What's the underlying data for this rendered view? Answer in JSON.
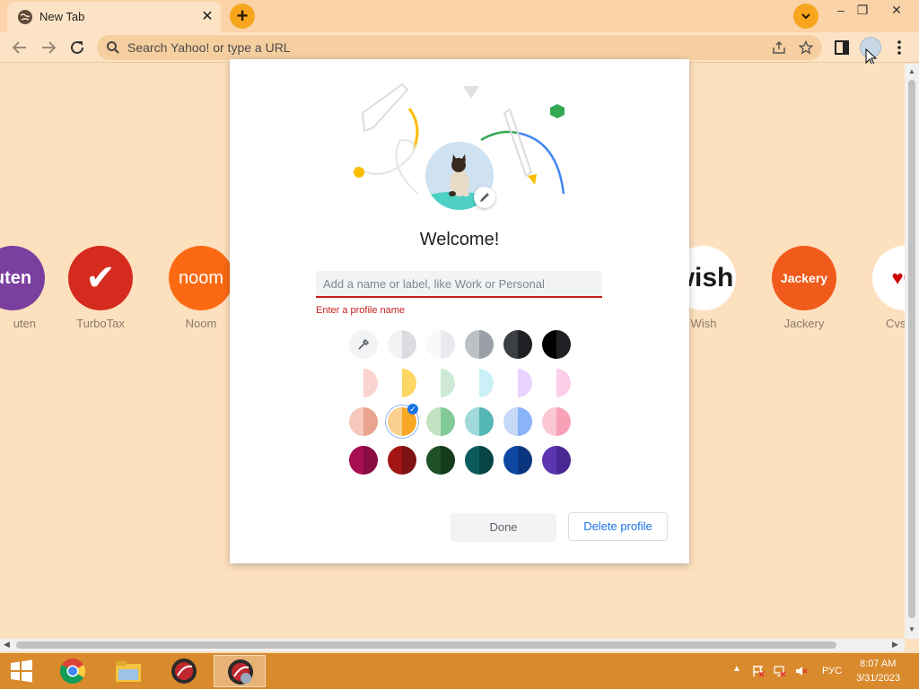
{
  "browser": {
    "tab": {
      "title": "New Tab",
      "close": "✕"
    },
    "new_tab": "+",
    "window_controls": [
      "–",
      "❐",
      "✕"
    ],
    "omnibox": {
      "placeholder": "Search Yahoo! or type a URL"
    }
  },
  "shortcuts": [
    {
      "label": "uten",
      "tile_text": "uten",
      "color": "#7b3fa0"
    },
    {
      "label": "TurboTax",
      "tile_text": "✔",
      "color": "#d52b1e"
    },
    {
      "label": "Noom",
      "tile_text": "noom",
      "color": "#fb6a13"
    },
    {
      "label": "Wish",
      "tile_text": "wish",
      "color": "#ffffff"
    },
    {
      "label": "Jackery",
      "tile_text": "Jackery",
      "color": "#f05a1a"
    },
    {
      "label": "Cvs Ph",
      "tile_text": "♥C",
      "color": "#ffffff"
    }
  ],
  "dialog": {
    "title": "Welcome!",
    "name_placeholder": "Add a name or label, like Work or Personal",
    "error": "Enter a profile name",
    "done": "Done",
    "delete": "Delete profile",
    "color_rows": [
      [
        [
          "#f1f3f4",
          "#dadce0"
        ],
        [
          "#f8f9fa",
          "#e8eaed"
        ],
        [
          "#bdc1c6",
          "#9aa0a6"
        ],
        [
          "#3c4043",
          "#202124"
        ],
        [
          "#000000",
          "#202124"
        ]
      ],
      [
        [
          "#fff",
          "#fad2cf"
        ],
        [
          "#fff",
          "#fdd663"
        ],
        [
          "#fff",
          "#ceead6"
        ],
        [
          "#fff",
          "#cbf0f8"
        ],
        [
          "#fff",
          "#e9d2fd"
        ],
        [
          "#fff",
          "#fdcfe8"
        ]
      ],
      [
        [
          "#f6c7bd",
          "#e8a48e"
        ],
        [
          "#fbd08e",
          "#f9a825"
        ],
        [
          "#c3e2c2",
          "#81c995"
        ],
        [
          "#9fd9d9",
          "#55b6b6"
        ],
        [
          "#c6d9f6",
          "#8ab4f8"
        ],
        [
          "#fcc7d5",
          "#f8a1b6"
        ]
      ],
      [
        [
          "#a50e50",
          "#8a0a42"
        ],
        [
          "#a31515",
          "#7f1212"
        ],
        [
          "#1e5128",
          "#153c1d"
        ],
        [
          "#0b5c5c",
          "#074545"
        ],
        [
          "#0d47a1",
          "#0a3680"
        ],
        [
          "#5e35b1",
          "#4a2891"
        ]
      ]
    ]
  },
  "taskbar": {
    "lang": "РУС",
    "time": "8:07 AM",
    "date": "3/31/2023"
  }
}
